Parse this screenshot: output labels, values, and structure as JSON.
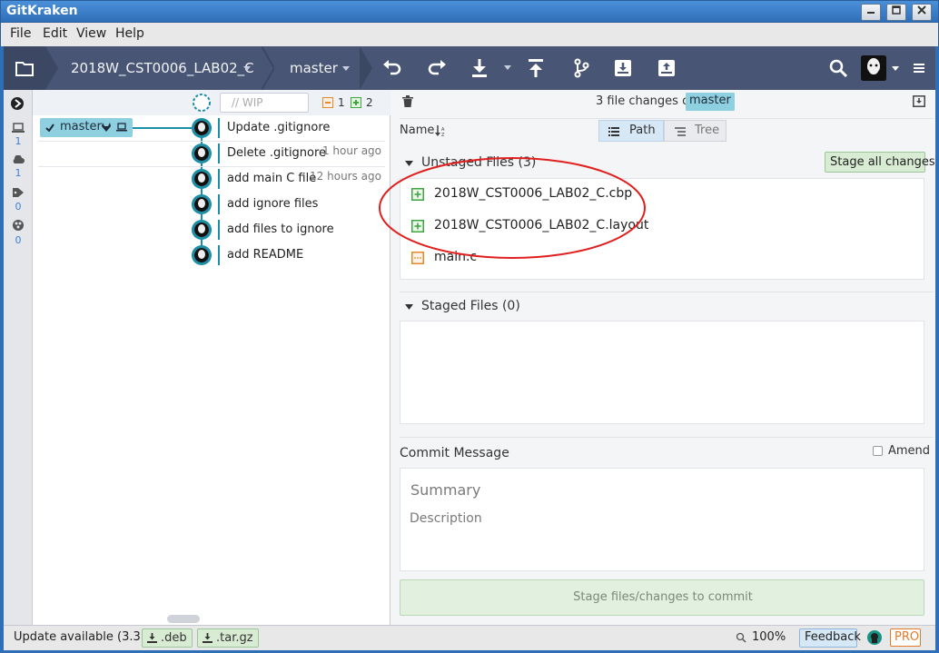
{
  "window": {
    "title": "GitKraken"
  },
  "menu": [
    "File",
    "Edit",
    "View",
    "Help"
  ],
  "toolbar": {
    "repo_name": "2018W_CST0006_LAB02_C",
    "branch_name": "master",
    "icons": [
      "folder-icon",
      "undo-icon",
      "redo-icon",
      "pull-icon",
      "push-icon",
      "branch-icon",
      "stash-icon",
      "pop-icon",
      "search-icon",
      "menu-icon"
    ]
  },
  "sidebar": {
    "local_count": "1",
    "remote_count": "1",
    "tags_count": "0",
    "submodules_count": "0"
  },
  "graph": {
    "wip_placeholder": "// WIP",
    "wip_removed": "1",
    "wip_added": "2",
    "branch_label": "master",
    "commits": [
      {
        "message": "Update .gitignore",
        "time": ""
      },
      {
        "message": "Delete .gitignore",
        "time": "1 hour ago"
      },
      {
        "message": "add main C file",
        "time": "12 hours ago"
      },
      {
        "message": "add ignore files",
        "time": ""
      },
      {
        "message": "add files to ignore",
        "time": ""
      },
      {
        "message": "add README",
        "time": ""
      }
    ]
  },
  "right": {
    "changes_text": "3 file changes on",
    "branch": "master",
    "sort_label": "Name",
    "path_label": "Path",
    "tree_label": "Tree",
    "unstaged_header": "Unstaged Files (3)",
    "stage_all_label": "Stage all changes",
    "unstaged_files": [
      {
        "name": "2018W_CST0006_LAB02_C.cbp",
        "status": "added"
      },
      {
        "name": "2018W_CST0006_LAB02_C.layout",
        "status": "added"
      },
      {
        "name": "main.c",
        "status": "modified"
      }
    ],
    "staged_header": "Staged Files (0)",
    "commit_message_label": "Commit Message",
    "amend_label": "Amend",
    "summary_placeholder": "Summary",
    "description_placeholder": "Description",
    "commit_button": "Stage files/changes to commit"
  },
  "status": {
    "update_text": "Update available (3.3.4)",
    "deb_label": ".deb",
    "targz_label": ".tar.gz",
    "zoom": "100%",
    "feedback_label": "Feedback",
    "pro_label": "PRO"
  },
  "colors": {
    "toolbar": "#485574",
    "accent": "#1b8ea8",
    "branch_bg": "#8fd0e0",
    "annotation": "#e0201f"
  }
}
